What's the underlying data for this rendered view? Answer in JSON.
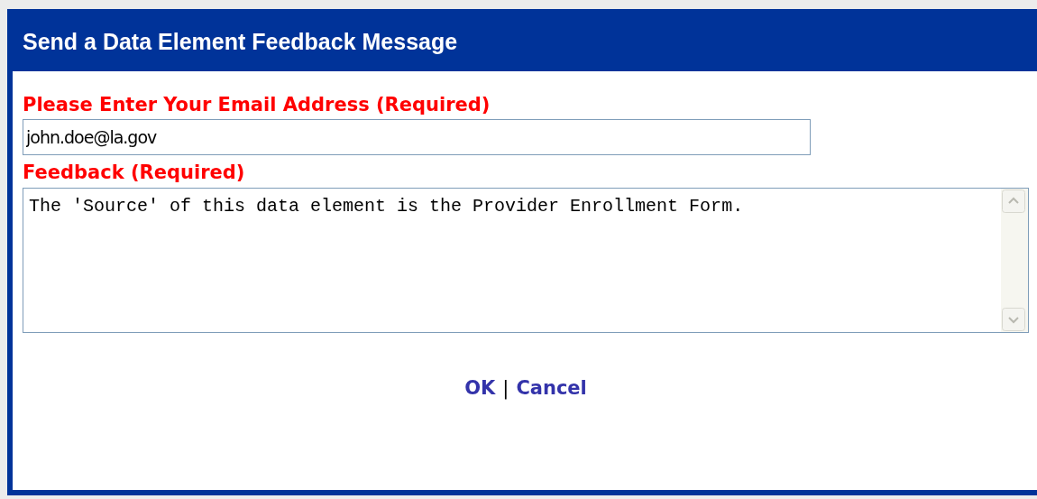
{
  "dialog": {
    "title": "Send a Data Element Feedback Message"
  },
  "email": {
    "label": "Please Enter Your Email Address (Required)",
    "value": "john.doe@la.gov"
  },
  "feedback": {
    "label": "Feedback (Required)",
    "value": "The 'Source' of this data element is the Provider Enrollment Form."
  },
  "actions": [
    {
      "label": "OK"
    },
    {
      "label": "Cancel"
    }
  ],
  "separator": "|"
}
